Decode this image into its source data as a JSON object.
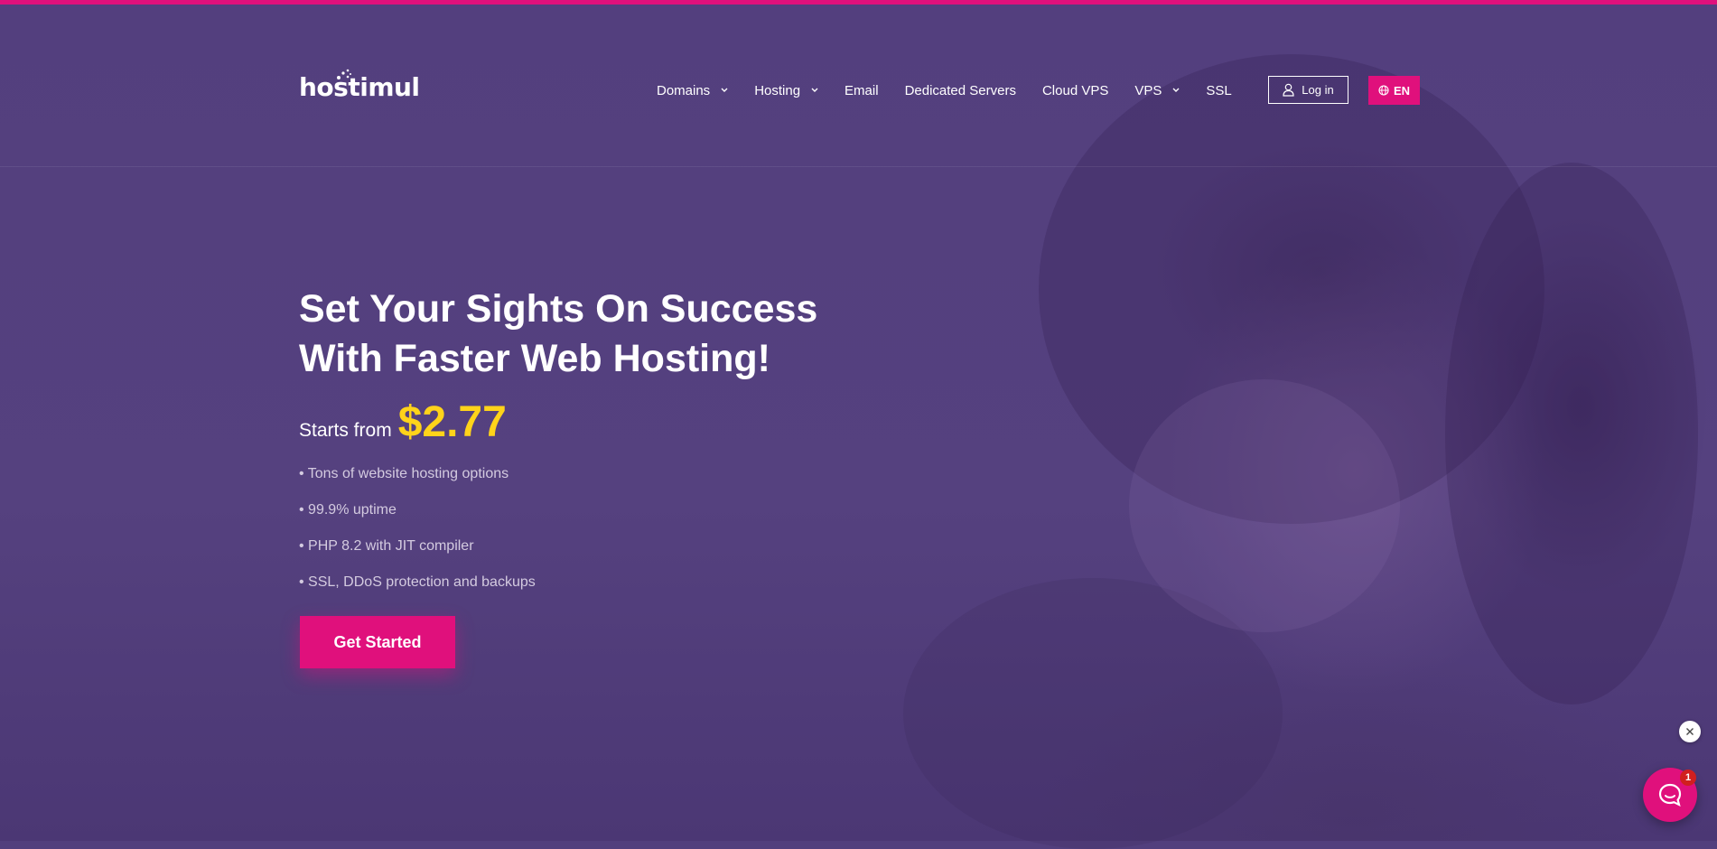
{
  "colors": {
    "accent": "#e0107c",
    "price": "#ffd31a",
    "background": "#523f7d",
    "top_bar": "#e0107c"
  },
  "header": {
    "logo_text": "hostimul",
    "nav": [
      {
        "label": "Domains",
        "has_dropdown": true,
        "icon": "chevron-down-icon"
      },
      {
        "label": "Hosting",
        "has_dropdown": true,
        "icon": "chevron-down-icon"
      },
      {
        "label": "Email",
        "has_dropdown": false
      },
      {
        "label": "Dedicated Servers",
        "has_dropdown": false
      },
      {
        "label": "Cloud VPS",
        "has_dropdown": false
      },
      {
        "label": "VPS",
        "has_dropdown": true,
        "icon": "chevron-down-icon"
      },
      {
        "label": "SSL",
        "has_dropdown": false
      }
    ],
    "login_label": "Log in",
    "login_icon": "user-icon",
    "lang_label": "EN",
    "lang_icon": "globe-icon"
  },
  "hero": {
    "title_line1": "Set Your Sights On Success",
    "title_line2": "With Faster Web Hosting!",
    "starts_from": "Starts from",
    "price": "$2.77",
    "features": [
      "• Tons of website hosting options",
      "• 99.9% uptime",
      "• PHP 8.2 with JIT compiler",
      "• SSL, DDoS protection and backups"
    ],
    "cta_label": "Get Started"
  },
  "chat": {
    "badge_count": "1",
    "close_icon": "close-icon",
    "chat_icon": "chat-bubble-icon"
  }
}
